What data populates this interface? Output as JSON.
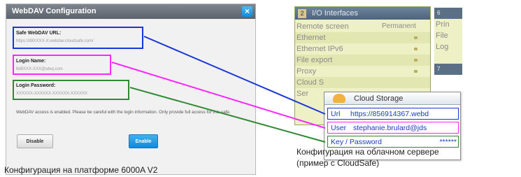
{
  "dialog": {
    "title": "WebDAV Configuration",
    "close_glyph": "×",
    "url_label": "Safe WebDAV URL:",
    "url_value": "https://d8XXXX-X.webdav.cloudsafe.com/",
    "login_label": "Login Name:",
    "login_value": "6d8XXX-XXX@ateq.com",
    "password_label": "Login Password:",
    "password_value": "XXXXXX-XXXXXX-XXXXXX-XXXXXX",
    "notice": "WebDAV access is enabled. Please be careful with the login information. Only provide full access for this safe.",
    "disable_label": "Disable",
    "enable_label": "Enable"
  },
  "captions": {
    "left": "Конфигурация на платформе 6000A V2",
    "right_line1": "Конфигурация на облачном сервере",
    "right_line2": "(пример с CloudSafe)"
  },
  "io_panel": {
    "number": "2",
    "title": "I/O Interfaces",
    "rows": [
      {
        "label": "Remote screen",
        "value": "Permanent"
      },
      {
        "label": "Ethernet",
        "value": ""
      },
      {
        "label": "Ethernet IPv6",
        "value": ""
      },
      {
        "label": "File export",
        "value": ""
      },
      {
        "label": "Proxy",
        "value": ""
      },
      {
        "label": "Cloud S",
        "value": ""
      },
      {
        "label": "Ser",
        "value": ""
      }
    ]
  },
  "side_panel": {
    "number": "6",
    "rows": [
      "Prin",
      "File",
      "Log",
      "",
      "7"
    ]
  },
  "cloud_storage": {
    "title": "Cloud Storage",
    "url_label": "Url",
    "url_value": "https://856914367.webd",
    "user_label": "User",
    "user_value": "stephanie.brulard@jds",
    "key_label": "Key / Password",
    "key_value": "******"
  },
  "colors": {
    "url_link": "#1a35d8",
    "login_link": "#ff27ff",
    "password_link": "#2f8a33"
  }
}
